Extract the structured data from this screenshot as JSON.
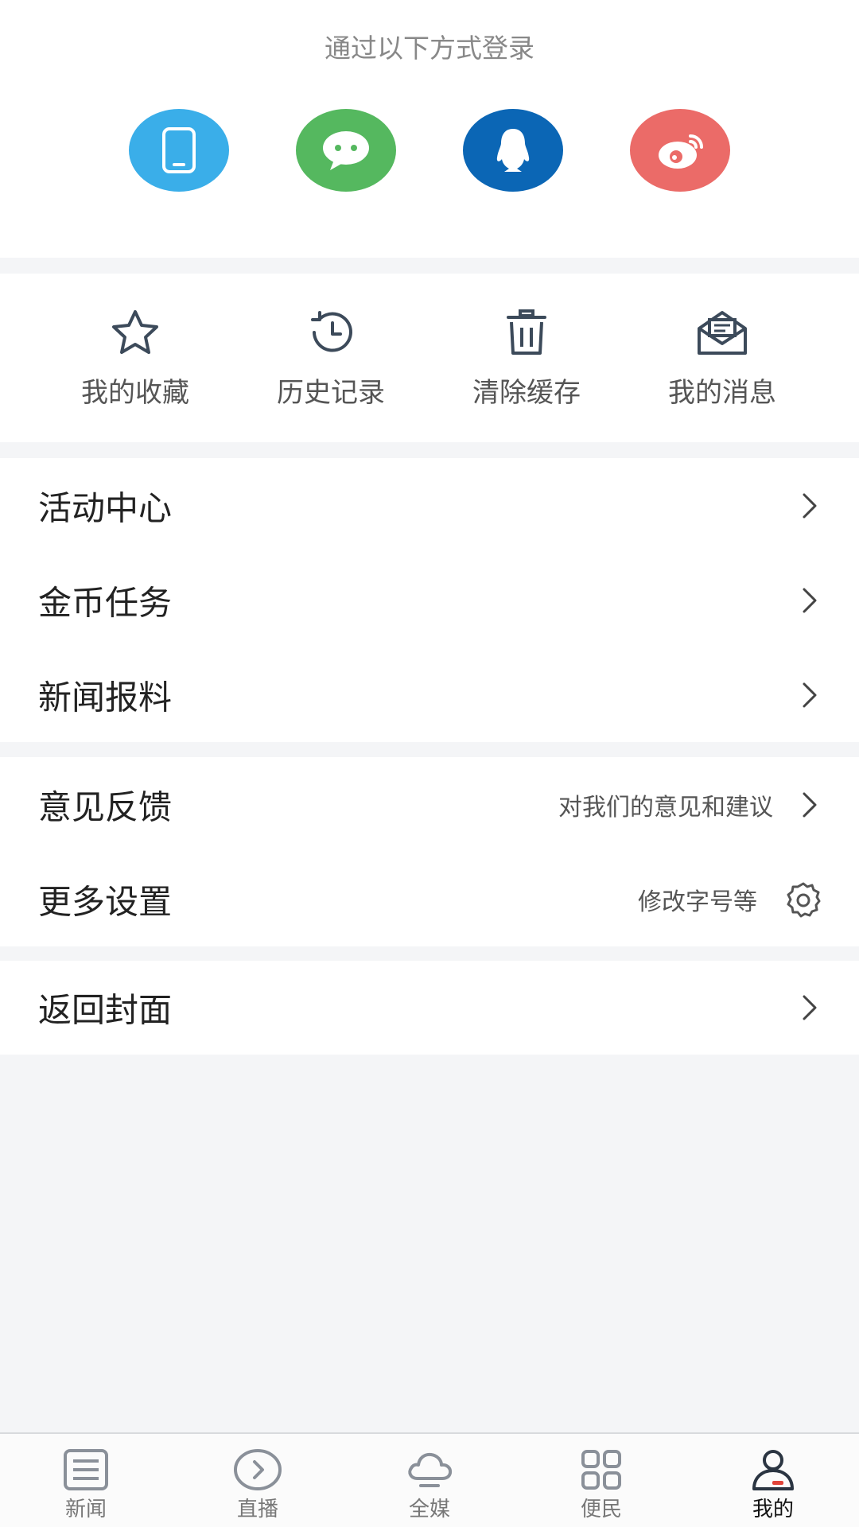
{
  "login": {
    "title": "通过以下方式登录",
    "methods": [
      {
        "icon": "phone-icon",
        "color": "#3aaee9"
      },
      {
        "icon": "wechat-icon",
        "color": "#55b85f"
      },
      {
        "icon": "qq-icon",
        "color": "#0b66b5"
      },
      {
        "icon": "weibo-icon",
        "color": "#eb6b68"
      }
    ]
  },
  "quick_actions": [
    {
      "label": "我的收藏",
      "icon": "star-icon"
    },
    {
      "label": "历史记录",
      "icon": "history-icon"
    },
    {
      "label": "清除缓存",
      "icon": "trash-icon"
    },
    {
      "label": "我的消息",
      "icon": "mail-icon"
    }
  ],
  "menu": {
    "activity_center": "活动中心",
    "coin_tasks": "金币任务",
    "news_tipoff": "新闻报料",
    "feedback": "意见反馈",
    "feedback_sub": "对我们的意见和建议",
    "more_settings": "更多设置",
    "more_settings_sub": "修改字号等",
    "back_to_cover": "返回封面"
  },
  "tabs": [
    {
      "label": "新闻",
      "icon": "news-icon",
      "active": false
    },
    {
      "label": "直播",
      "icon": "live-icon",
      "active": false
    },
    {
      "label": "全媒",
      "icon": "cloud-icon",
      "active": false
    },
    {
      "label": "便民",
      "icon": "grid-icon",
      "active": false
    },
    {
      "label": "我的",
      "icon": "profile-icon",
      "active": true
    }
  ],
  "colors": {
    "background": "#f4f5f7",
    "icon_stroke": "#3c4a5a",
    "tab_inactive": "#8a9099",
    "tab_active": "#2b3542",
    "active_accent": "#e0443a"
  }
}
